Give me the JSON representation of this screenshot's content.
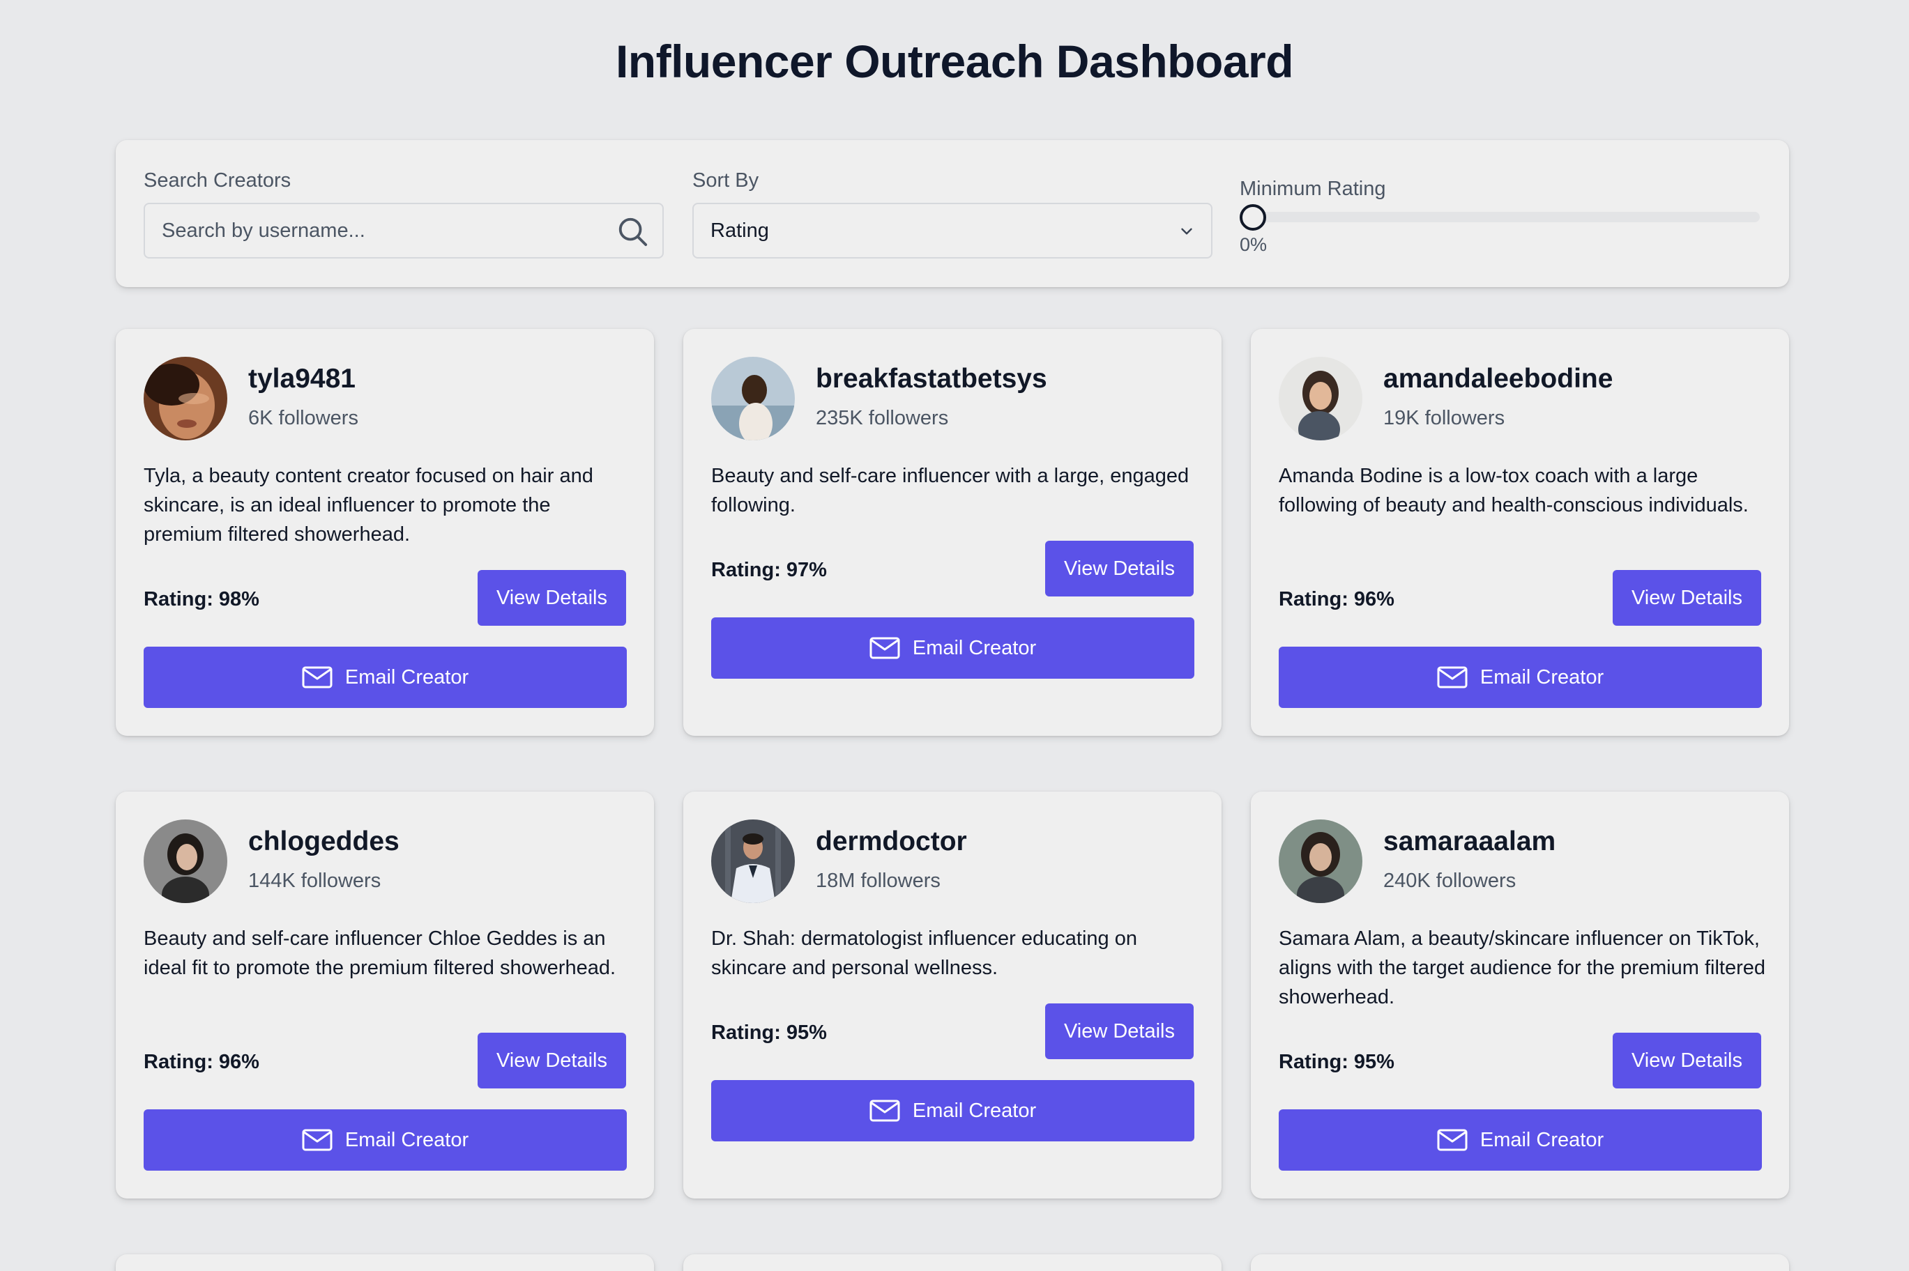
{
  "header": {
    "title": "Influencer Outreach Dashboard"
  },
  "filters": {
    "search_label": "Search Creators",
    "search_placeholder": "Search by username...",
    "search_value": "",
    "sort_label": "Sort By",
    "sort_value": "Rating",
    "rating_label": "Minimum Rating",
    "rating_value_text": "0%",
    "rating_value": 0
  },
  "accent_color": "#5b52e8",
  "creators": [
    {
      "username": "tyla9481",
      "followers": "6K followers",
      "bio": "Tyla, a beauty content creator focused on hair and skincare, is an ideal influencer to promote the premium filtered showerhead.",
      "rating": "Rating: 98%",
      "view_label": "View Details",
      "email_label": "Email Creator"
    },
    {
      "username": "breakfastatbetsys",
      "followers": "235K followers",
      "bio": "Beauty and self-care influencer with a large, engaged following.",
      "rating": "Rating: 97%",
      "view_label": "View Details",
      "email_label": "Email Creator"
    },
    {
      "username": "amandaleebodine",
      "followers": "19K followers",
      "bio": "Amanda Bodine is a low-tox coach with a large following of beauty and health-conscious individuals.",
      "rating": "Rating: 96%",
      "view_label": "View Details",
      "email_label": "Email Creator"
    },
    {
      "username": "chlogeddes",
      "followers": "144K followers",
      "bio": "Beauty and self-care influencer Chloe Geddes is an ideal fit to promote the premium filtered showerhead.",
      "rating": "Rating: 96%",
      "view_label": "View Details",
      "email_label": "Email Creator"
    },
    {
      "username": "dermdoctor",
      "followers": "18M followers",
      "bio": "Dr. Shah: dermatologist influencer educating on skincare and personal wellness.",
      "rating": "Rating: 95%",
      "view_label": "View Details",
      "email_label": "Email Creator"
    },
    {
      "username": "samaraaalam",
      "followers": "240K followers",
      "bio": "Samara Alam, a beauty/skincare influencer on TikTok, aligns with the target audience for the premium filtered showerhead.",
      "rating": "Rating: 95%",
      "view_label": "View Details",
      "email_label": "Email Creator"
    }
  ]
}
